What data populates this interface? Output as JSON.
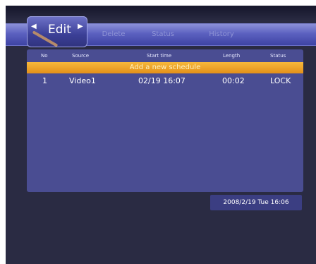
{
  "tabs": {
    "edit": "Edit",
    "delete": "Delete",
    "status": "Status",
    "history": "History"
  },
  "table": {
    "headers": [
      "No",
      "Source",
      "Start time",
      "Length",
      "Status"
    ],
    "add_row": "Add a new schedule",
    "rows": [
      {
        "no": "1",
        "source": "Video1",
        "start_time": "02/19 16:07",
        "length": "00:02",
        "status": "LOCK"
      }
    ]
  },
  "datetime": "2008/2/19 Tue 16:06",
  "colors": {
    "background": "#2a2b43",
    "tab_bar": "#5c61c0",
    "panel": "#4a4d92",
    "highlight": "#f0a22a"
  }
}
